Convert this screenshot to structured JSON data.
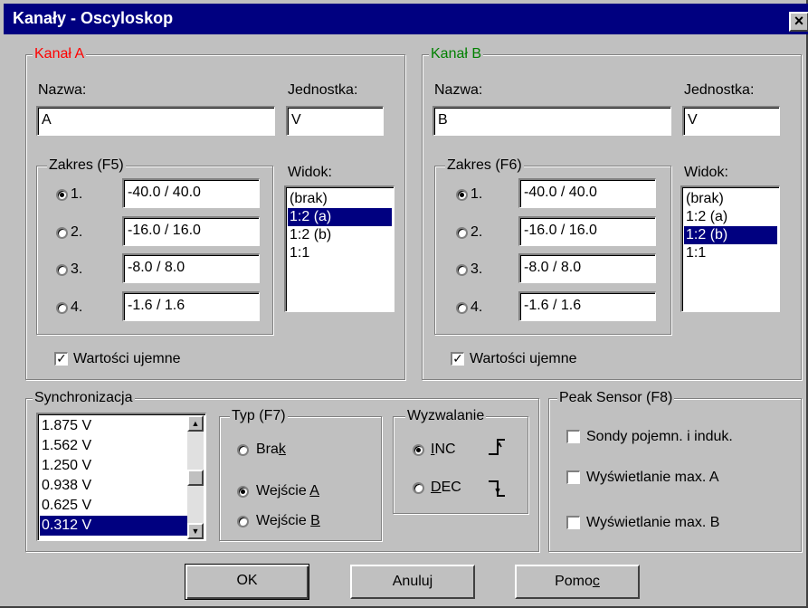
{
  "window": {
    "title": "Kanały - Oscyloskop",
    "close_label": "×"
  },
  "channel_a": {
    "group_label": "Kanał A",
    "name_label": "Nazwa:",
    "name_value": "A",
    "unit_label": "Jednostka:",
    "unit_value": "V",
    "range_group_label": "Zakres (F5)",
    "ranges": [
      {
        "label": "1.",
        "value": "-40.0 / 40.0",
        "selected": true
      },
      {
        "label": "2.",
        "value": "-16.0 / 16.0",
        "selected": false
      },
      {
        "label": "3.",
        "value": "-8.0 / 8.0",
        "selected": false
      },
      {
        "label": "4.",
        "value": "-1.6 / 1.6",
        "selected": false
      }
    ],
    "view_label": "Widok:",
    "view_items": [
      "(brak)",
      "1:2 (a)",
      "1:2 (b)",
      "1:1"
    ],
    "view_selected": "1:2 (a)",
    "negative_label": "Wartości ujemne",
    "negative_checked": true
  },
  "channel_b": {
    "group_label": "Kanał B",
    "name_label": "Nazwa:",
    "name_value": "B",
    "unit_label": "Jednostka:",
    "unit_value": "V",
    "range_group_label": "Zakres (F6)",
    "ranges": [
      {
        "label": "1.",
        "value": "-40.0 / 40.0",
        "selected": true
      },
      {
        "label": "2.",
        "value": "-16.0 / 16.0",
        "selected": false
      },
      {
        "label": "3.",
        "value": "-8.0 / 8.0",
        "selected": false
      },
      {
        "label": "4.",
        "value": "-1.6 / 1.6",
        "selected": false
      }
    ],
    "view_label": "Widok:",
    "view_items": [
      "(brak)",
      "1:2 (a)",
      "1:2 (b)",
      "1:1"
    ],
    "view_selected": "1:2 (b)",
    "negative_label": "Wartości ujemne",
    "negative_checked": true
  },
  "sync": {
    "group_label": "Synchronizacja",
    "levels": [
      "1.875 V",
      "1.562 V",
      "1.250 V",
      "0.938 V",
      "0.625 V",
      "0.312 V"
    ],
    "selected_level": "0.312 V",
    "type_group_label": "Typ (F7)",
    "type_options": [
      {
        "pre": "Bra",
        "key": "k",
        "post": "",
        "selected": false
      },
      {
        "pre": "Wejście ",
        "key": "A",
        "post": "",
        "selected": true
      },
      {
        "pre": "Wejście ",
        "key": "B",
        "post": "",
        "selected": false
      }
    ],
    "trigger_group_label": "Wyzwalanie",
    "trigger_options": [
      {
        "pre": "",
        "key": "I",
        "post": "NC",
        "selected": true
      },
      {
        "pre": "",
        "key": "D",
        "post": "EC",
        "selected": false
      }
    ]
  },
  "peak": {
    "group_label": "Peak Sensor (F8)",
    "options": [
      {
        "label": "Sondy pojemn. i induk.",
        "checked": false
      },
      {
        "label": "Wyświetlanie max. A",
        "checked": false
      },
      {
        "label": "Wyświetlanie max. B",
        "checked": false
      }
    ]
  },
  "buttons": {
    "ok": "OK",
    "cancel": "Anuluj",
    "help_pre": "Pomo",
    "help_key": "c"
  },
  "colors": {
    "title_bar": "#000080",
    "channel_a": "#ff0000",
    "channel_b": "#008000",
    "selection": "#000080"
  }
}
